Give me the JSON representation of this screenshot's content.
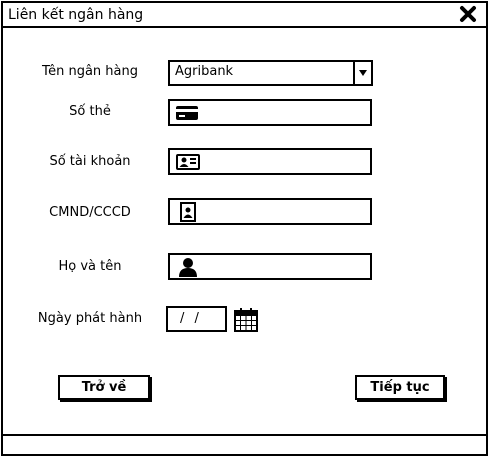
{
  "window": {
    "title": "Liên kết ngân hàng"
  },
  "form": {
    "bank_label": "Tên ngân hàng",
    "bank_value": "Agribank",
    "card_label": "Số thẻ",
    "account_label": "Số tài khoản",
    "id_label": "CMND/CCCD",
    "name_label": "Họ và tên",
    "issue_date_label": "Ngày phát hành",
    "issue_date_value": "/ /"
  },
  "icons": {
    "close": "close-icon",
    "dropdown": "chevron-down-icon",
    "card": "credit-card-icon",
    "account": "id-card-icon",
    "id": "id-badge-icon",
    "name": "user-icon",
    "calendar": "calendar-icon"
  },
  "buttons": {
    "back": "Trở về",
    "next": "Tiếp tục"
  }
}
